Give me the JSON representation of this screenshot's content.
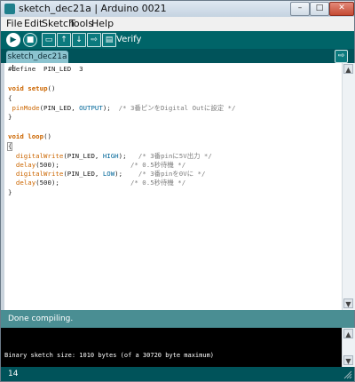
{
  "window": {
    "title": "sketch_dec21a | Arduino 0021",
    "minimize_glyph": "–",
    "maximize_glyph": "□",
    "close_glyph": "✕"
  },
  "menu": [
    "File",
    "Edit",
    "Sketch",
    "Tools",
    "Help"
  ],
  "toolbar": {
    "verify_label": "Verify",
    "icons": [
      "verify-run-icon",
      "stop-icon",
      "new-icon",
      "open-icon",
      "save-icon",
      "upload-icon",
      "serial-monitor-icon"
    ],
    "glyphs": [
      "▶",
      "■",
      "▭",
      "↑",
      "↓",
      "⇨",
      "▤"
    ],
    "accent_color": "#006468"
  },
  "tab": {
    "name": "sketch_dec21a",
    "menu_glyph": "⇨"
  },
  "code": {
    "l1_a": "#define  PIN_LED  3",
    "l2_kw": "void",
    "l2_fn": "setup",
    "l2_rest": "()",
    "l3": "{",
    "l4_fn": "pinMode",
    "l4_mid": "(PIN_LED, ",
    "l4_const": "OUTPUT",
    "l4_end": ");  ",
    "l4_cmt": "/* 3番ピンをDigital Outに設定 */",
    "l5": "}",
    "l6_kw": "void",
    "l6_fn": "loop",
    "l6_rest": "()",
    "l7": "{",
    "l8_fn": "digitalWrite",
    "l8_mid": "(PIN_LED, ",
    "l8_const": "HIGH",
    "l8_end": ");   ",
    "l8_cmt": "/* 3番pinに5V出力 */",
    "l9_fn": "delay",
    "l9_mid": "(500);                  ",
    "l9_cmt": "/* 0.5秒待機 */",
    "l10_fn": "digitalWrite",
    "l10_mid": "(PIN_LED, ",
    "l10_const": "LOW",
    "l10_end": ");    ",
    "l10_cmt": "/* 3番pinを0Vに */",
    "l11_fn": "delay",
    "l11_mid": "(500);                  ",
    "l11_cmt": "/* 0.5秒待機 */",
    "l12": "}"
  },
  "status": {
    "message": "Done compiling."
  },
  "console": {
    "output": "Binary sketch size: 1010 bytes (of a 30720 byte maximum)"
  },
  "footer": {
    "line_number": "14"
  }
}
